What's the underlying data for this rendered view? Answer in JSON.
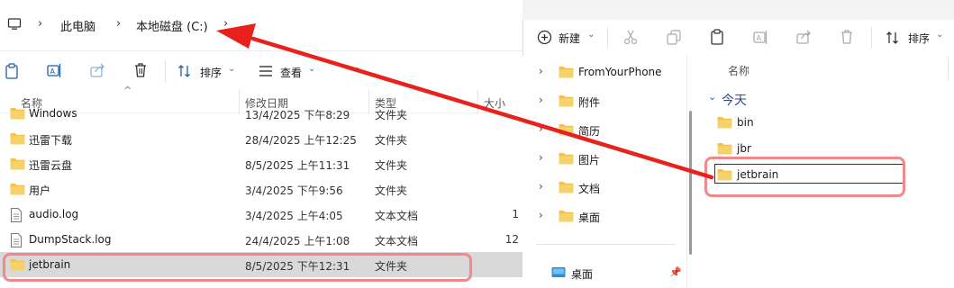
{
  "left": {
    "breadcrumb": [
      "此电脑",
      "本地磁盘 (C:)"
    ],
    "toolbar": {
      "sort": "排序",
      "view": "查看",
      "more": "···"
    },
    "columns": {
      "name": "名称",
      "date": "修改日期",
      "type": "类型",
      "size": "大小"
    },
    "rows": [
      {
        "name": "Windows",
        "date": "13/4/2025 下午8:29",
        "type": "文件夹",
        "size": "",
        "icon": "folder"
      },
      {
        "name": "迅雷下载",
        "date": "28/4/2025 上午12:25",
        "type": "文件夹",
        "size": "",
        "icon": "folder"
      },
      {
        "name": "迅雷云盘",
        "date": "8/5/2025 上午11:31",
        "type": "文件夹",
        "size": "",
        "icon": "folder"
      },
      {
        "name": "用户",
        "date": "3/4/2025 下午9:56",
        "type": "文件夹",
        "size": "",
        "icon": "folder"
      },
      {
        "name": "audio.log",
        "date": "3/4/2025 上午4:05",
        "type": "文本文档",
        "size": "1",
        "icon": "file"
      },
      {
        "name": "DumpStack.log",
        "date": "24/4/2025 上午1:08",
        "type": "文本文档",
        "size": "12",
        "icon": "file"
      },
      {
        "name": "jetbrain",
        "date": "8/5/2025 下午12:31",
        "type": "文件夹",
        "size": "",
        "icon": "folder"
      }
    ]
  },
  "right": {
    "toolbar": {
      "new": "新建",
      "sort": "排序"
    },
    "nav": [
      {
        "label": "FromYourPhone"
      },
      {
        "label": "附件"
      },
      {
        "label": "简历"
      },
      {
        "label": "图片"
      },
      {
        "label": "文档"
      },
      {
        "label": "桌面"
      }
    ],
    "pinned": {
      "label": "桌面"
    },
    "column_name": "名称",
    "group": "今天",
    "items": [
      {
        "label": "bin"
      },
      {
        "label": "jbr"
      },
      {
        "label": "jetbrain"
      }
    ]
  },
  "colors": {
    "folder": "#f2c14e",
    "highlight": "#f08a8a",
    "arrow": "#e8221b",
    "selected_row": "#d9d9d9"
  }
}
